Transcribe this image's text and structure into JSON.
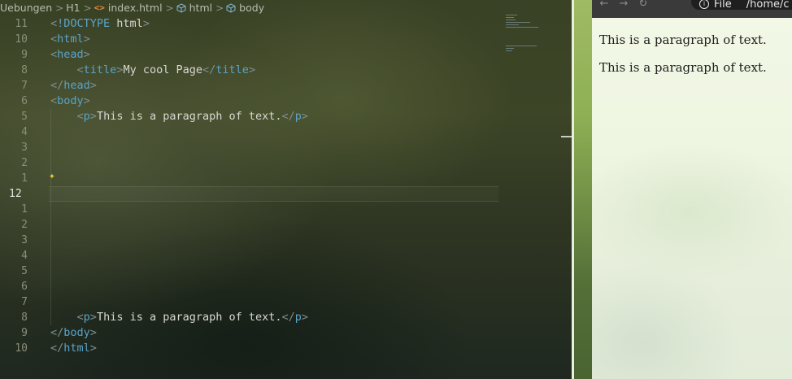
{
  "breadcrumb": {
    "items": [
      {
        "label": "Uebungen",
        "icon": ""
      },
      {
        "label": "H1",
        "icon": ""
      },
      {
        "label": "index.html",
        "icon": "code-brackets-icon"
      },
      {
        "label": "html",
        "icon": "cube-icon"
      },
      {
        "label": "body",
        "icon": "cube-icon"
      }
    ],
    "separator": ">"
  },
  "editor": {
    "line_numbers": [
      "11",
      "10",
      "9",
      "8",
      "7",
      "6",
      "5",
      "4",
      "3",
      "2",
      "1",
      "12",
      "1",
      "2",
      "3",
      "4",
      "5",
      "6",
      "7",
      "8",
      "9",
      "10"
    ],
    "current_line_index": 11,
    "lines": [
      "<!DOCTYPE html>",
      "<html>",
      "<head>",
      "<title>My cool Page</title>",
      "</head>",
      "<body>",
      "<p>This is a paragraph of text.</p>",
      "",
      "",
      "",
      "",
      "",
      "",
      "",
      "",
      "",
      "",
      "",
      "",
      "<p>This is a paragraph of text.</p>",
      "</body>",
      "</html>"
    ]
  },
  "colors": {
    "tag": "#5aa4c8",
    "punctuation": "#7e8e8e",
    "text": "#d8d8d0",
    "sparkle": "#f2c230",
    "code_icon": "#e08a3c"
  },
  "browser": {
    "url_scheme": "File",
    "url_path": "/home/c",
    "paragraphs": [
      "This is a paragraph of text.",
      "This is a paragraph of text."
    ]
  }
}
